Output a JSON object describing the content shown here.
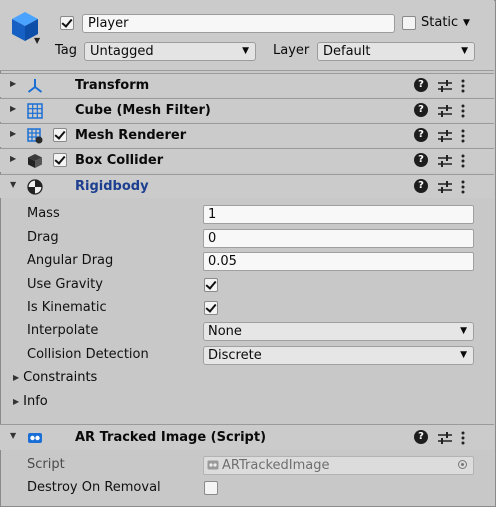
{
  "header": {
    "active": true,
    "name": "Player",
    "static_label": "Static",
    "static_checked": false,
    "tag_label": "Tag",
    "tag_value": "Untagged",
    "layer_label": "Layer",
    "layer_value": "Default"
  },
  "components": {
    "transform": {
      "title": "Transform"
    },
    "mesh_filter": {
      "title": "Cube (Mesh Filter)"
    },
    "mesh_renderer": {
      "title": "Mesh Renderer",
      "enabled": true
    },
    "box_collider": {
      "title": "Box Collider",
      "enabled": true
    },
    "rigidbody": {
      "title": "Rigidbody",
      "mass_label": "Mass",
      "mass": "1",
      "drag_label": "Drag",
      "drag": "0",
      "angular_drag_label": "Angular Drag",
      "angular_drag": "0.05",
      "use_gravity_label": "Use Gravity",
      "use_gravity": true,
      "is_kinematic_label": "Is Kinematic",
      "is_kinematic": true,
      "interpolate_label": "Interpolate",
      "interpolate": "None",
      "collision_label": "Collision Detection",
      "collision": "Discrete",
      "constraints_label": "Constraints",
      "info_label": "Info"
    },
    "ar_tracked": {
      "title": "AR Tracked Image (Script)",
      "script_label": "Script",
      "script_value": "ARTrackedImage",
      "destroy_label": "Destroy On Removal",
      "destroy_on_removal": false
    }
  },
  "icons": {
    "gameobject": "cube-icon",
    "transform": "transform-axes-icon",
    "mesh_filter": "mesh-grid-icon",
    "mesh_renderer": "mesh-renderer-icon",
    "box_collider": "box-collider-icon",
    "rigidbody": "rigidbody-icon",
    "script": "script-icon",
    "help": "help-icon",
    "preset": "preset-sliders-icon",
    "menu": "kebab-menu-icon"
  },
  "colors": {
    "accent_blue": "#1a6fd6",
    "rigidbody_title": "#1c3f8f",
    "panel_bg": "#c8c8c8"
  }
}
